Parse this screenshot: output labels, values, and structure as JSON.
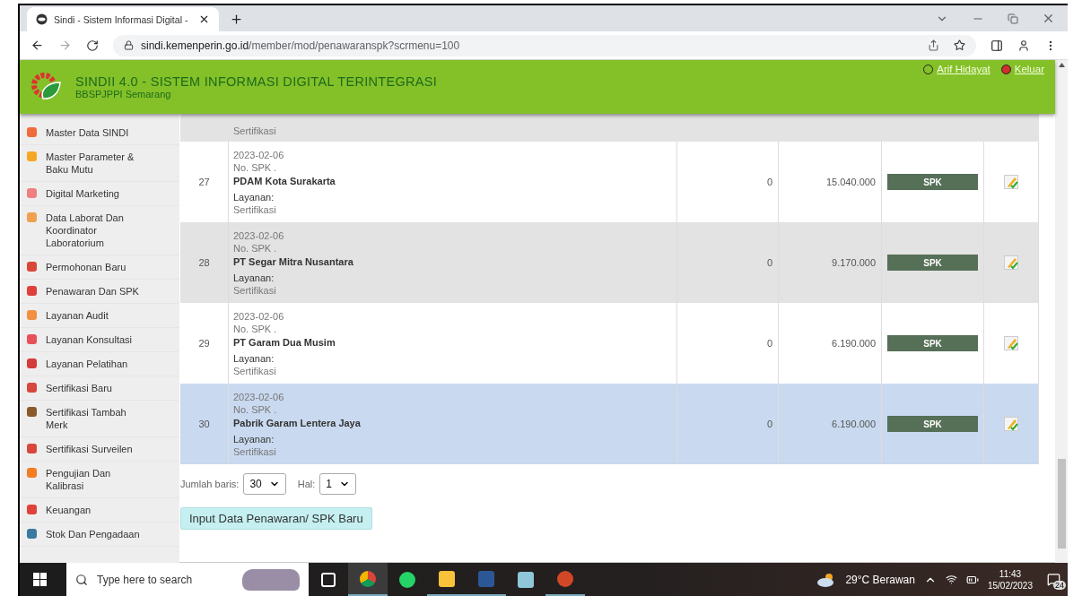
{
  "browser": {
    "tab_title": "Sindi - Sistem Informasi Digital -",
    "url_domain": "sindi.kemenperin.go.id",
    "url_path": "/member/mod/penawaranspk?scrmenu=100"
  },
  "header": {
    "title": "SINDII 4.0 - SISTEM INFORMASI DIGITAL TERINTEGRASI",
    "subtitle": "BBSPJPPI Semarang",
    "user": "Arif Hidayat",
    "logout": "Keluar"
  },
  "sidebar": {
    "items": [
      {
        "label": "Master Data SINDI",
        "color": "#f26b3a"
      },
      {
        "label": "Master Parameter & Baku Mutu",
        "color": "#f5a623"
      },
      {
        "label": "Digital Marketing",
        "color": "#f08080"
      },
      {
        "label": "Data Laborat Dan Koordinator Laboratorium",
        "color": "#f0a050"
      },
      {
        "label": "Permohonan Baru",
        "color": "#d9463a"
      },
      {
        "label": "Penawaran Dan SPK",
        "color": "#e0403a"
      },
      {
        "label": "Layanan Audit",
        "color": "#f09040"
      },
      {
        "label": "Layanan Konsultasi",
        "color": "#e8505a"
      },
      {
        "label": "Layanan Pelatihan",
        "color": "#d43a3a"
      },
      {
        "label": "Sertifikasi Baru",
        "color": "#d9463b"
      },
      {
        "label": "Sertifikasi Tambah Merk",
        "color": "#8a5a2a"
      },
      {
        "label": "Sertifikasi Surveilen",
        "color": "#d9473c"
      },
      {
        "label": "Pengujian Dan Kalibrasi",
        "color": "#f57c20"
      },
      {
        "label": "Keuangan",
        "color": "#e0413b"
      },
      {
        "label": "Stok Dan Pengadaan",
        "color": "#3a7aa0"
      }
    ]
  },
  "table": {
    "partial_row": {
      "service": "Sertifikasi"
    },
    "rows": [
      {
        "no": "27",
        "date": "2023-02-06",
        "spk_no": "No. SPK .",
        "company": "PDAM Kota Surakarta",
        "service_label": "Layanan:",
        "service": "Sertifikasi",
        "column_3": "0",
        "amount": "15.040.000",
        "status": "SPK",
        "selected": false
      },
      {
        "no": "28",
        "date": "2023-02-06",
        "spk_no": "No. SPK .",
        "company": "PT Segar Mitra Nusantara",
        "service_label": "Layanan:",
        "service": "Sertifikasi",
        "column_3": "0",
        "amount": "9.170.000",
        "status": "SPK",
        "selected": false
      },
      {
        "no": "29",
        "date": "2023-02-06",
        "spk_no": "No. SPK .",
        "company": "PT Garam Dua Musim",
        "service_label": "Layanan:",
        "service": "Sertifikasi",
        "column_3": "0",
        "amount": "6.190.000",
        "status": "SPK",
        "selected": false
      },
      {
        "no": "30",
        "date": "2023-02-06",
        "spk_no": "No. SPK .",
        "company": "Pabrik Garam Lentera Jaya",
        "service_label": "Layanan:",
        "service": "Sertifikasi",
        "column_3": "0",
        "amount": "6.190.000",
        "status": "SPK",
        "selected": true
      }
    ]
  },
  "pager": {
    "rows_label": "Jumlah baris:",
    "rows_value": "30",
    "page_label": "Hal:",
    "page_value": "1"
  },
  "new_button": "Input Data Penawaran/ SPK Baru",
  "taskbar": {
    "search_placeholder": "Type here to search",
    "weather": "29°C Berawan",
    "time": "11:43",
    "date": "15/02/2023",
    "notifications": "24"
  }
}
